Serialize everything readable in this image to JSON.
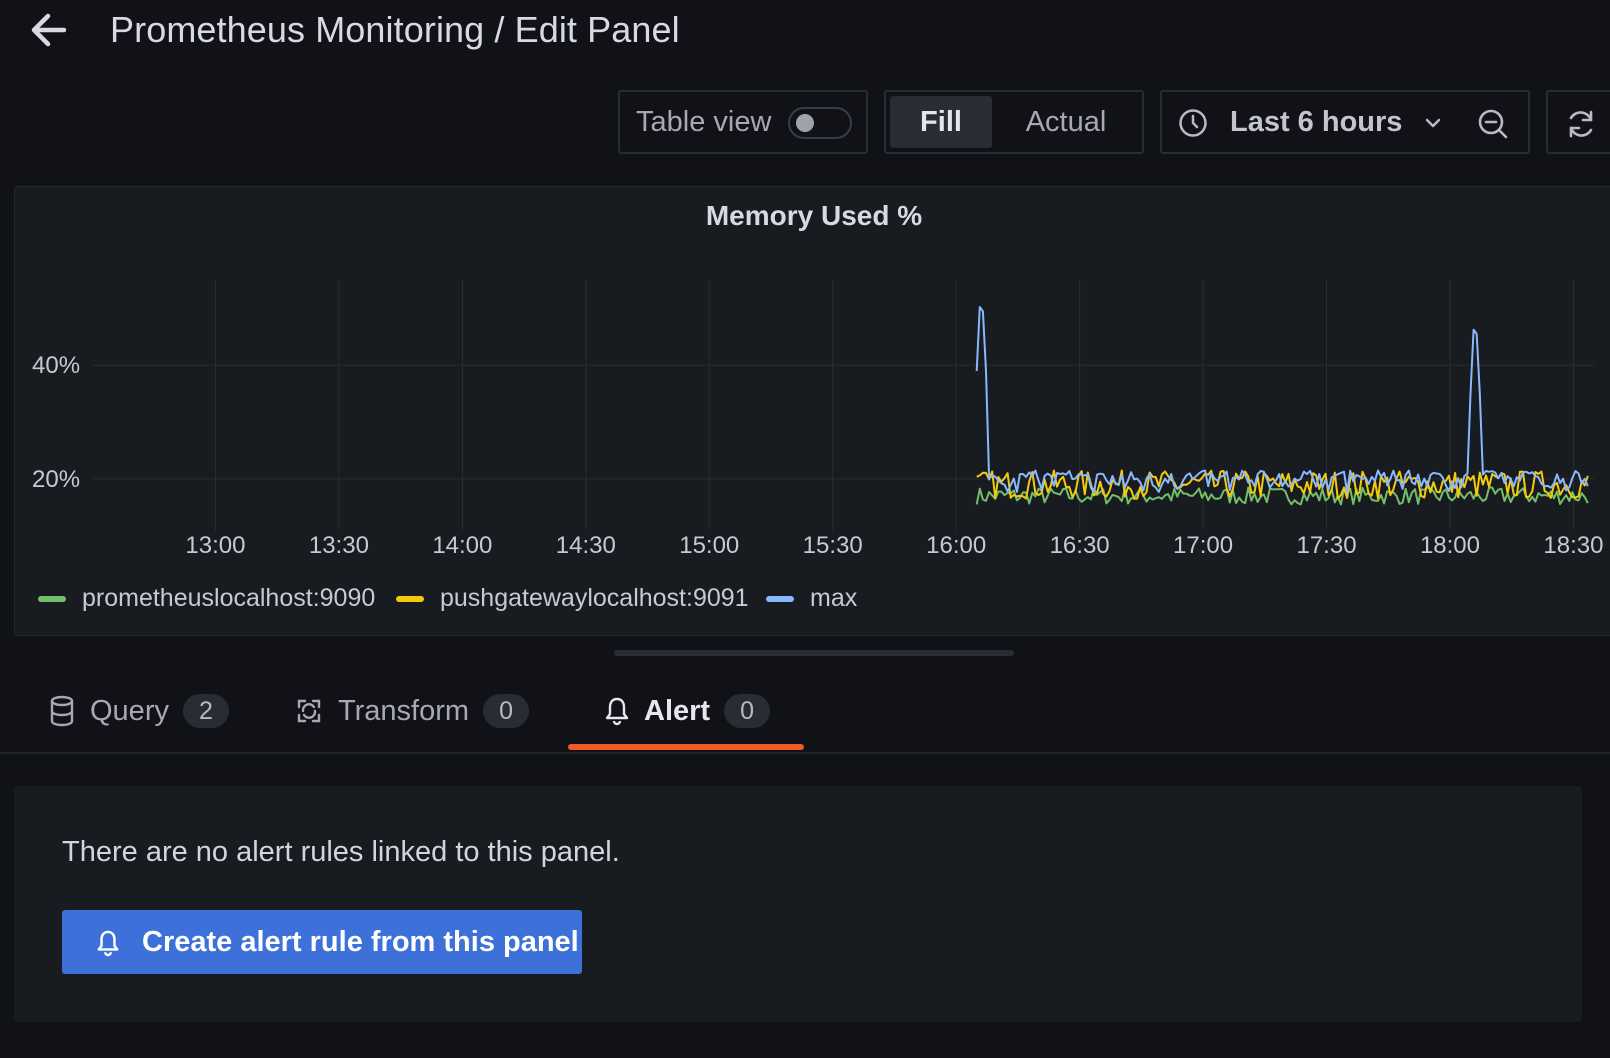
{
  "header": {
    "title": "Prometheus Monitoring / Edit Panel",
    "back_icon": "arrow-left-icon"
  },
  "toolbar": {
    "table_view_label": "Table view",
    "table_view_on": false,
    "fill_label": "Fill",
    "actual_label": "Actual",
    "selected_mode": "Fill",
    "time_range_label": "Last 6 hours",
    "icons": [
      "clock-icon",
      "chevron-down-icon",
      "zoom-out-icon",
      "refresh-icon"
    ]
  },
  "panel": {
    "title": "Memory Used %"
  },
  "chart_data": {
    "type": "line",
    "title": "Memory Used %",
    "xlabel": "",
    "ylabel": "",
    "x_ticks": [
      "13:00",
      "13:30",
      "14:00",
      "14:30",
      "15:00",
      "15:30",
      "16:00",
      "16:30",
      "17:00",
      "17:30",
      "18:00",
      "18:30"
    ],
    "y_ticks": [
      "20%",
      "40%"
    ],
    "y_tick_values": [
      20,
      40
    ],
    "ylim": [
      11,
      55
    ],
    "xlim": [
      "12:30",
      "18:35"
    ],
    "grid": true,
    "legend_position": "bottom-left",
    "data_start": "16:05",
    "data_end": "18:34",
    "series": [
      {
        "name": "prometheuslocalhost:9090",
        "color": "#73bf69",
        "approx_level": 17,
        "spikes": []
      },
      {
        "name": "pushgatewaylocalhost:9091",
        "color": "#f2cc0c",
        "approx_level": 19,
        "spikes": []
      },
      {
        "name": "max",
        "color": "#8ab8ff",
        "approx_level": 19,
        "spikes": [
          {
            "x": "16:06",
            "y": 51
          },
          {
            "x": "18:06",
            "y": 47
          }
        ]
      }
    ]
  },
  "tabs": [
    {
      "label": "Query",
      "count": "2",
      "icon": "database-icon",
      "active": false
    },
    {
      "label": "Transform",
      "count": "0",
      "icon": "transform-icon",
      "active": false
    },
    {
      "label": "Alert",
      "count": "0",
      "icon": "bell-icon",
      "active": true
    }
  ],
  "alert": {
    "message": "There are no alert rules linked to this panel.",
    "button_label": "Create alert rule from this panel"
  },
  "colors": {
    "background": "#111217",
    "panel": "#181b1f",
    "accent_tab": "#f05a28",
    "primary_button": "#3d71d9"
  }
}
